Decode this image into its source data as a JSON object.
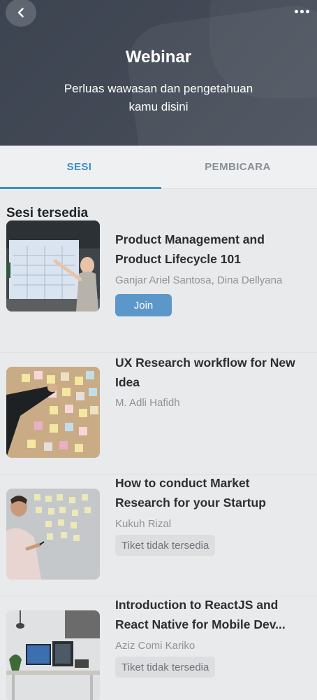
{
  "header": {
    "title": "Webinar",
    "subtitle_line1": "Perluas wawasan dan pengetahuan",
    "subtitle_line2": "kamu disini",
    "back_icon": "chevron-left-icon",
    "more_icon": "more-horizontal-icon"
  },
  "tabs": [
    {
      "label": "SESI",
      "active": true
    },
    {
      "label": "PEMBICARA",
      "active": false
    }
  ],
  "section_title": "Sesi tersedia",
  "sessions": [
    {
      "title_line1": "Product Management and",
      "title_line2": "Product Lifecycle 101",
      "speakers": "Ganjar Ariel Santosa, Dina Dellyana",
      "action": "Join"
    },
    {
      "title_line1": "UX Research workflow for New",
      "title_line2": "Idea",
      "speakers": "M. Adli Hafidh",
      "action": ""
    },
    {
      "title_line1": "How to conduct Market",
      "title_line2": "Research for your Startup",
      "speakers": "Kukuh Rizal",
      "action": "Tiket tidak tersedia"
    },
    {
      "title_line1": "Introduction to ReactJS and",
      "title_line2": "React Native for Mobile Dev...",
      "speakers": "Aziz Comi Kariko",
      "action": "Tiket tidak tersedia"
    }
  ],
  "colors": {
    "accent": "#3e8fc6",
    "join_button": "#5b98c9",
    "header_bg": "#414854",
    "page_bg": "#e9eaeb"
  }
}
